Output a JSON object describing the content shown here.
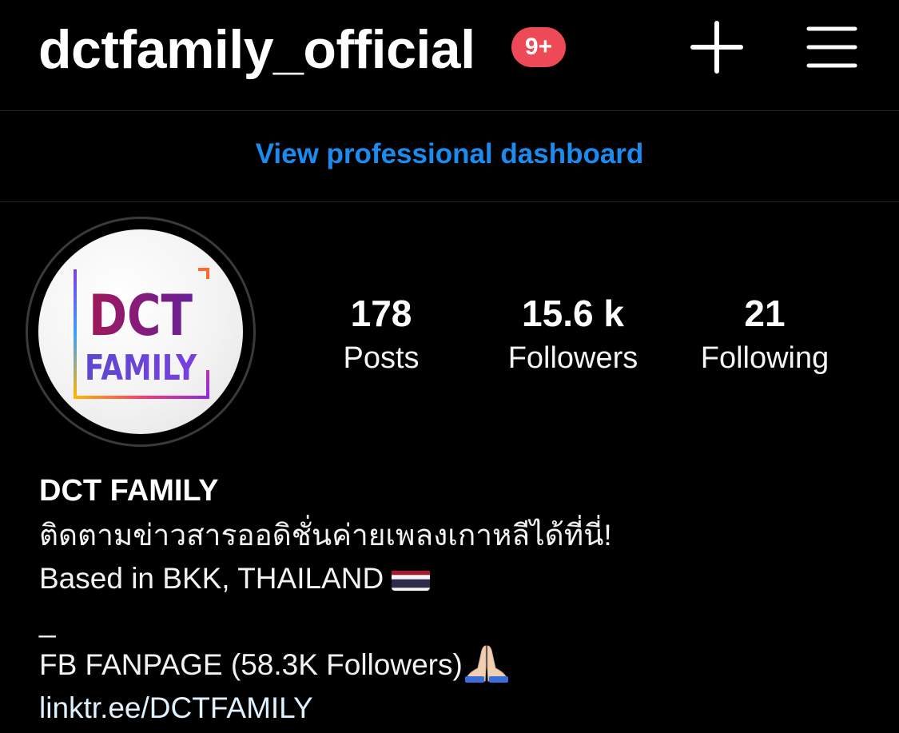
{
  "header": {
    "username": "dctfamily_official",
    "notification_badge": "9+",
    "create_icon": "plus-icon",
    "menu_icon": "hamburger-menu-icon"
  },
  "dashboard": {
    "link_label": "View professional dashboard"
  },
  "profile": {
    "avatar": {
      "logo_line1": "DCT",
      "logo_line2": "FAMILY"
    },
    "stats": [
      {
        "value": "178",
        "label": "Posts"
      },
      {
        "value": "15.6 k",
        "label": "Followers"
      },
      {
        "value": "21",
        "label": "Following"
      }
    ]
  },
  "bio": {
    "display_name": "DCT FAMILY",
    "line1": "ติดตามข่าวสารออดิชั่นค่ายเพลงเกาหลีได้ที่นี่!",
    "line2": "Based in BKK, THAILAND",
    "line3": "_",
    "line4": "FB FANPAGE (58.3K Followers)",
    "link": "linktr.ee/DCTFAMILY"
  },
  "colors": {
    "background": "#000000",
    "accent_link": "#1a8cf0",
    "badge": "#ed4956",
    "divider": "#262626"
  }
}
